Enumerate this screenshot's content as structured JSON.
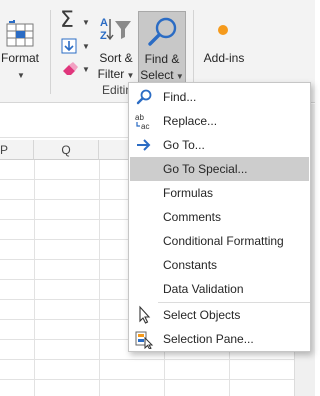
{
  "ribbon": {
    "format_label": "Format",
    "sort_filter": {
      "line1": "Sort &",
      "line2": "Filter"
    },
    "find_select": {
      "line1": "Find &",
      "line2": "Select"
    },
    "addins_label": "Add-ins",
    "group_label": "Editin"
  },
  "sheet": {
    "columns": [
      "P",
      "Q"
    ]
  },
  "menu": {
    "items": [
      {
        "label": "Find...",
        "icon": "find-icon"
      },
      {
        "label": "Replace...",
        "icon": "replace-icon"
      },
      {
        "label": "Go To...",
        "icon": "goto-arrow-icon"
      },
      {
        "label": "Go To Special...",
        "icon": ""
      },
      {
        "label": "Formulas",
        "icon": ""
      },
      {
        "label": "Comments",
        "icon": ""
      },
      {
        "label": "Conditional Formatting",
        "icon": ""
      },
      {
        "label": "Constants",
        "icon": ""
      },
      {
        "label": "Data Validation",
        "icon": ""
      },
      {
        "label": "Select Objects",
        "icon": "select-objects-icon"
      },
      {
        "label": "Selection Pane...",
        "icon": "selection-pane-icon"
      }
    ]
  },
  "colors": {
    "accent_blue": "#2b6cc4",
    "hover_gray": "#cdcdcd",
    "addins_orange": "#f59a1c",
    "clear_pink": "#e0367c"
  }
}
